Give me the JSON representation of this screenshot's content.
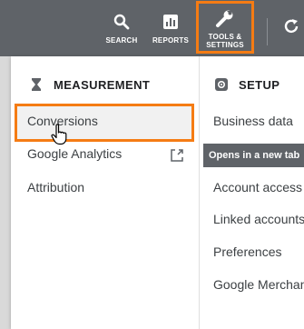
{
  "topbar": {
    "search_label": "SEARCH",
    "reports_label": "REPORTS",
    "tools_label": "TOOLS &\nSETTINGS"
  },
  "measurement": {
    "title": "MEASUREMENT",
    "items": [
      "Conversions",
      "Google Analytics",
      "Attribution"
    ]
  },
  "setup": {
    "title": "SETUP",
    "items": [
      "Business data",
      "Account access",
      "Linked accounts",
      "Preferences",
      "Google Merchant"
    ]
  },
  "tooltip": "Opens in a new tab",
  "colors": {
    "highlight": "#f57c14",
    "topbar": "#5f6368"
  },
  "icons": [
    "search-icon",
    "reports-icon",
    "wrench-icon",
    "refresh-icon",
    "hourglass-icon",
    "gear-icon",
    "external-link-icon",
    "hand-cursor-icon"
  ]
}
